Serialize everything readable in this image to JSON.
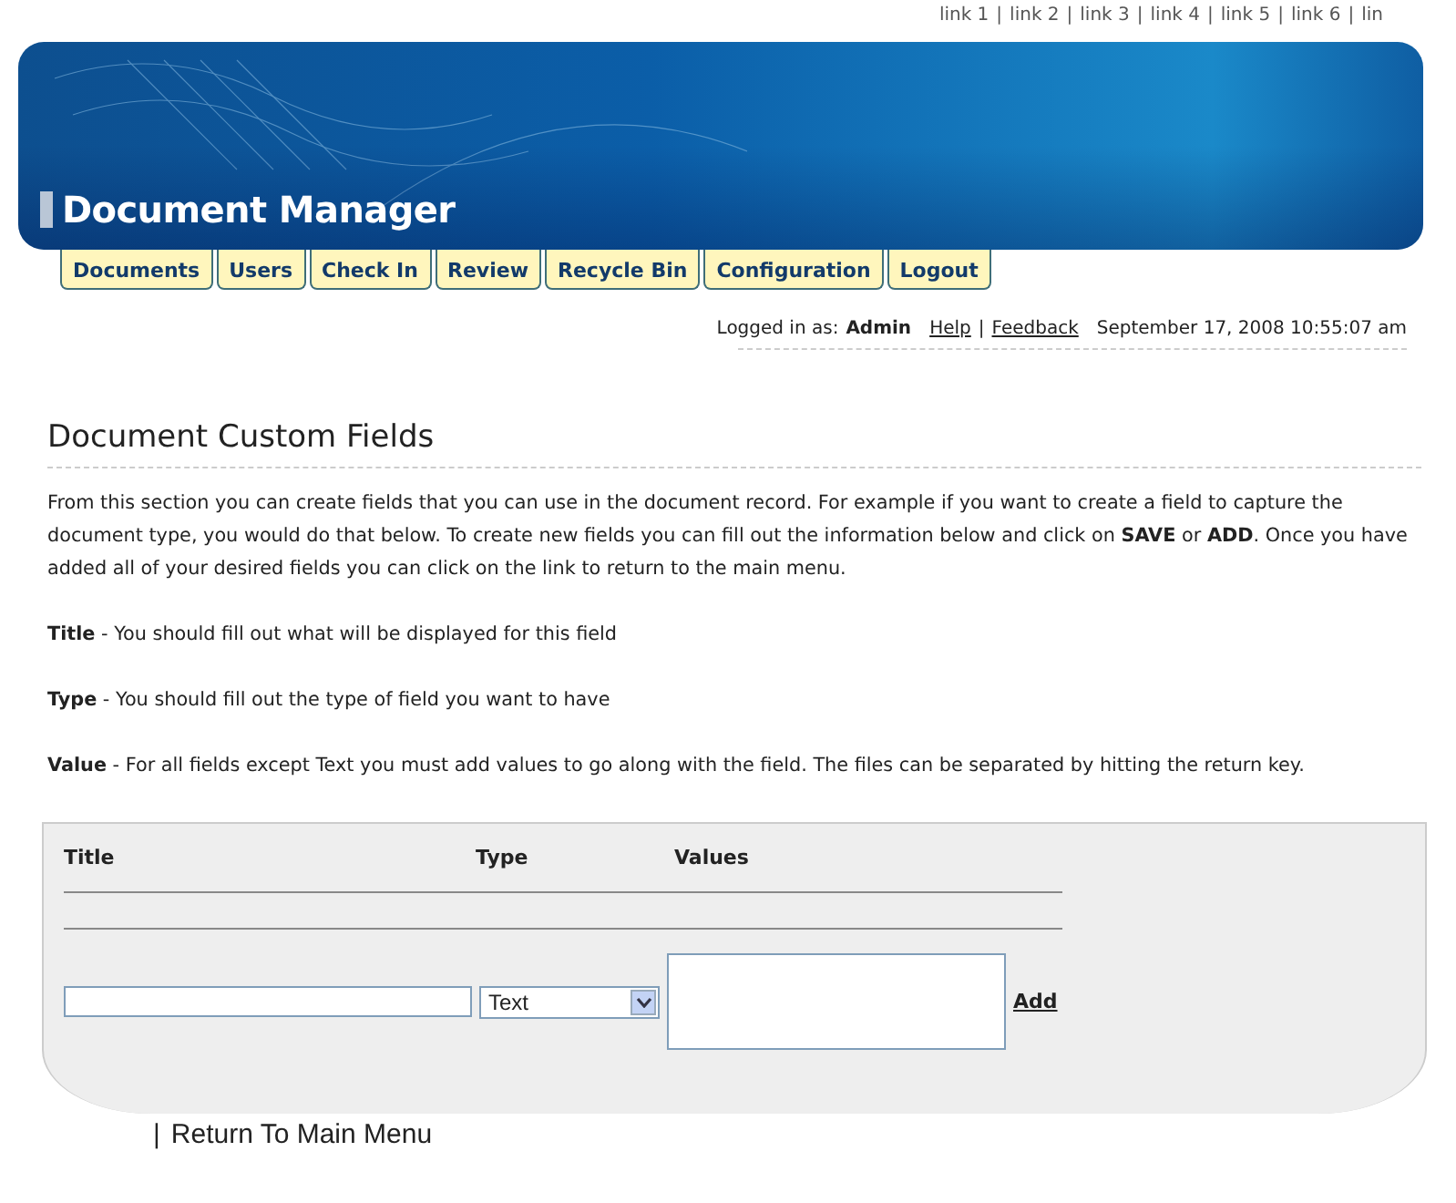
{
  "top_links": [
    "link 1",
    "link 2",
    "link 3",
    "link 4",
    "link 5",
    "link 6",
    "lin"
  ],
  "top_link_separators": [
    "|",
    "|",
    "|",
    "|",
    "|",
    "|"
  ],
  "header": {
    "title": "Document Manager"
  },
  "tabs": [
    {
      "label": "Documents"
    },
    {
      "label": "Users"
    },
    {
      "label": "Check In"
    },
    {
      "label": "Review"
    },
    {
      "label": "Recycle Bin"
    },
    {
      "label": "Configuration"
    },
    {
      "label": "Logout"
    }
  ],
  "status": {
    "logged_in_label": "Logged in as:",
    "user": "Admin",
    "help": "Help",
    "separator": "|",
    "feedback": "Feedback",
    "datetime": "September 17, 2008 10:55:07 am"
  },
  "page_title": "Document Custom Fields",
  "paragraphs": [
    "From this section you can create fields that you can use in the document record. For example if you want to create a field to capture the document type, you would do that below. To create new fields you can fill out the information below and click on **SAVE** or **ADD**. Once you have added all of your desired fields you can click on the link to return to the main menu.",
    "**Title** - You should fill out what will be displayed for this field",
    "**Type** - You should fill out the type of field you want to have",
    "**Value** - For all fields except Text you must add values to go along with the field. The files can be separated by hitting the return key."
  ],
  "form": {
    "columns": [
      "Title",
      "Type",
      "Values"
    ],
    "type_select": {
      "value": "Text"
    },
    "add_link": "Add"
  },
  "footer": {
    "separator": "|",
    "return_link": "Return To Main Menu"
  }
}
